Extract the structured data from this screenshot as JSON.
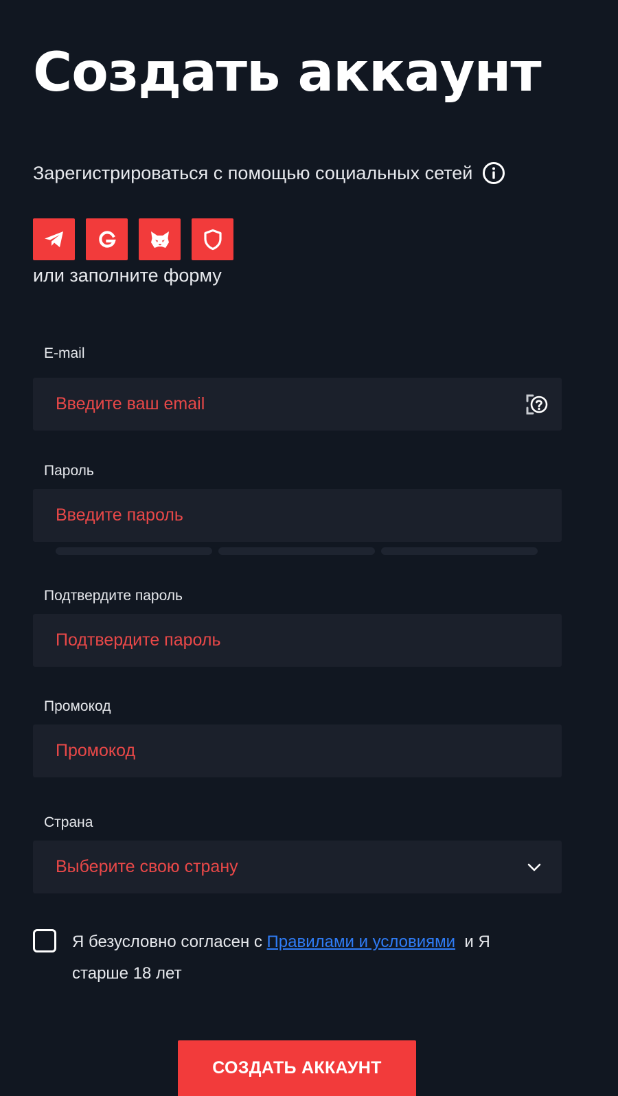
{
  "page": {
    "title": "Создать аккаунт"
  },
  "social": {
    "heading": "Зарегистрироваться с помощью социальных сетей",
    "buttons": [
      {
        "icon": "telegram-icon"
      },
      {
        "icon": "google-icon"
      },
      {
        "icon": "metamask-fox-icon"
      },
      {
        "icon": "shield-icon"
      }
    ],
    "or_text": "или заполните форму"
  },
  "form": {
    "email": {
      "label": "E-mail",
      "placeholder": "Введите ваш email"
    },
    "password": {
      "label": "Пароль",
      "placeholder": "Введите пароль"
    },
    "confirm_password": {
      "label": "Подтвердите пароль",
      "placeholder": "Подтвердите пароль"
    },
    "promo": {
      "label": "Промокод",
      "placeholder": "Промокод"
    },
    "country": {
      "label": "Страна",
      "selected": "Выберите свою страну"
    },
    "agreement": {
      "text_before": "Я безусловно согласен с ",
      "link_text": "Правилами и условиями",
      "text_after": "  и Я старше 18 лет"
    },
    "submit_label": "СОЗДАТЬ АККАУНТ"
  },
  "colors": {
    "background": "#111721",
    "field_background": "#1b202b",
    "accent": "#f23b3b",
    "placeholder": "#e94848",
    "link": "#2f7cf6"
  }
}
